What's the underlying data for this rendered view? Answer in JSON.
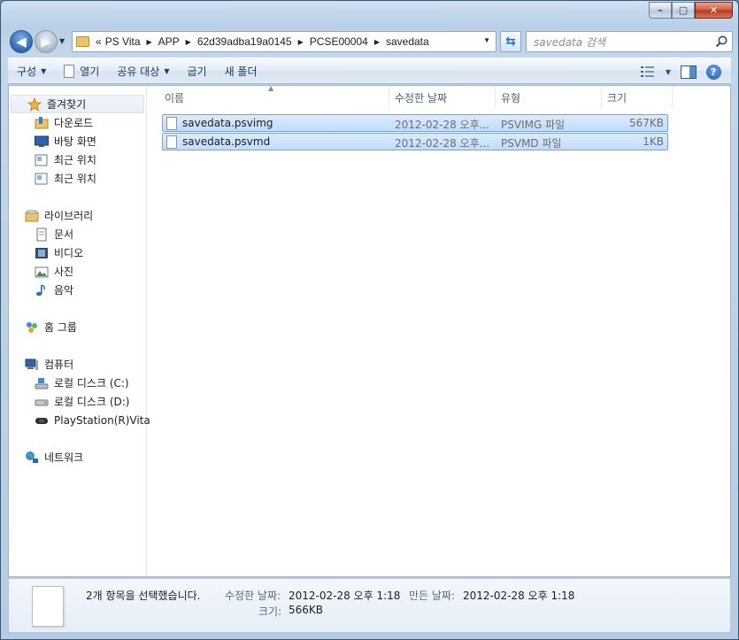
{
  "window": {
    "caption_buttons": {
      "minimize": "–",
      "maximize": "▢",
      "close": "✕"
    }
  },
  "nav": {
    "overflow": "«",
    "breadcrumbs": [
      "PS Vita",
      "APP",
      "62d39adba19a0145",
      "PCSE00004",
      "savedata"
    ],
    "search_placeholder": "savedata 검색"
  },
  "toolbar": {
    "organize": "구성",
    "open": "열기",
    "share": "공유 대상",
    "burn": "굽기",
    "new_folder": "새 폴더"
  },
  "sidebar": {
    "favorites": {
      "label": "즐겨찾기",
      "items": [
        "다운로드",
        "바탕 화면",
        "최근 위치",
        "최근 위치"
      ]
    },
    "libraries": {
      "label": "라이브러리",
      "items": [
        "문서",
        "비디오",
        "사진",
        "음악"
      ]
    },
    "homegroup": {
      "label": "홈 그룹"
    },
    "computer": {
      "label": "컴퓨터",
      "items": [
        "로컬 디스크 (C:)",
        "로컬 디스크 (D:)",
        "PlayStation(R)Vita"
      ]
    },
    "network": {
      "label": "네트워크"
    }
  },
  "columns": {
    "name": "이름",
    "modified": "수정한 날짜",
    "type": "유형",
    "size": "크기"
  },
  "files": [
    {
      "name": "savedata.psvimg",
      "modified": "2012-02-28 오후...",
      "type": "PSVIMG 파일",
      "size": "567KB"
    },
    {
      "name": "savedata.psvmd",
      "modified": "2012-02-28 오후...",
      "type": "PSVMD 파일",
      "size": "1KB"
    }
  ],
  "details": {
    "selection": "2개 항목을 선택했습니다.",
    "modified_label": "수정한 날짜:",
    "modified_value": "2012-02-28 오후 1:18",
    "created_label": "만든 날짜:",
    "created_value": "2012-02-28 오후 1:18",
    "size_label": "크기:",
    "size_value": "566KB"
  }
}
